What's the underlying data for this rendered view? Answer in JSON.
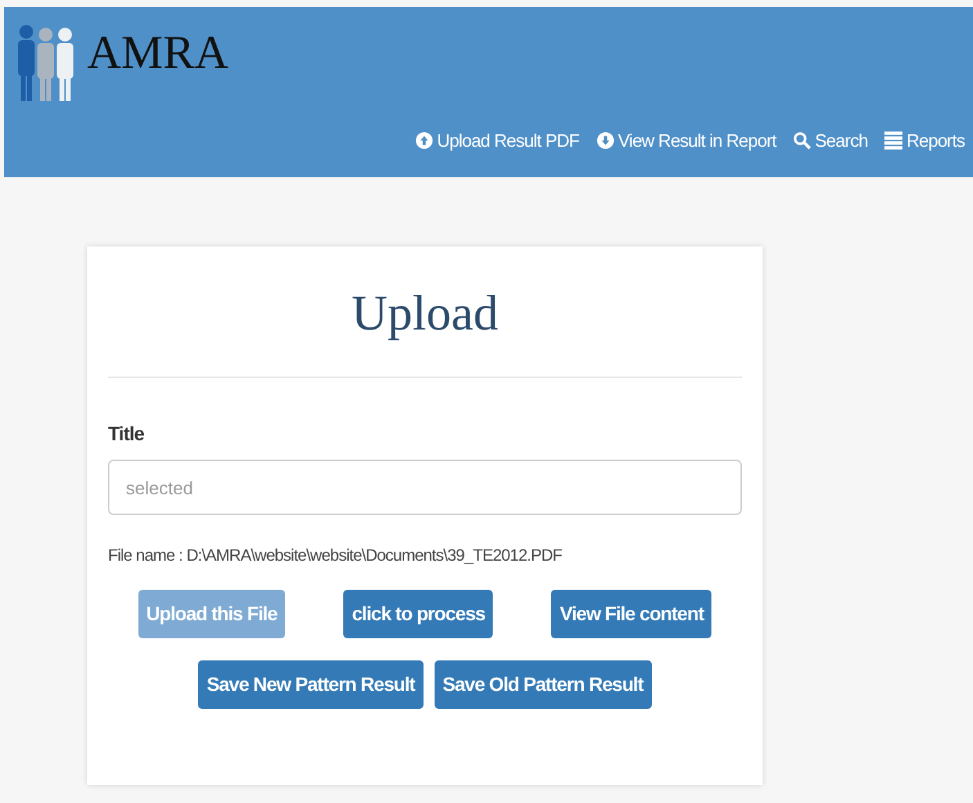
{
  "header": {
    "logo": "AMRA",
    "nav": [
      {
        "label": "Upload Result PDF",
        "kind": "upload"
      },
      {
        "label": "View Result in Report",
        "kind": "download"
      },
      {
        "label": "Search",
        "kind": "search"
      },
      {
        "label": "Reports",
        "kind": "list"
      }
    ]
  },
  "card": {
    "title": "Upload",
    "field_label": "Title",
    "field": {
      "placeholder": "selected"
    },
    "file_name": "File name : D:\\AMRA\\website\\website\\Documents\\39_TE2012.PDF",
    "button_rows": [
      [
        {
          "label": "Upload this File",
          "disabled": true
        },
        {
          "label": "click to process",
          "disabled": false
        },
        {
          "label": "View File content",
          "disabled": false
        }
      ],
      [
        {
          "label": "Save New Pattern Result",
          "disabled": false
        },
        {
          "label": "Save Old Pattern Result",
          "disabled": false
        }
      ]
    ]
  }
}
